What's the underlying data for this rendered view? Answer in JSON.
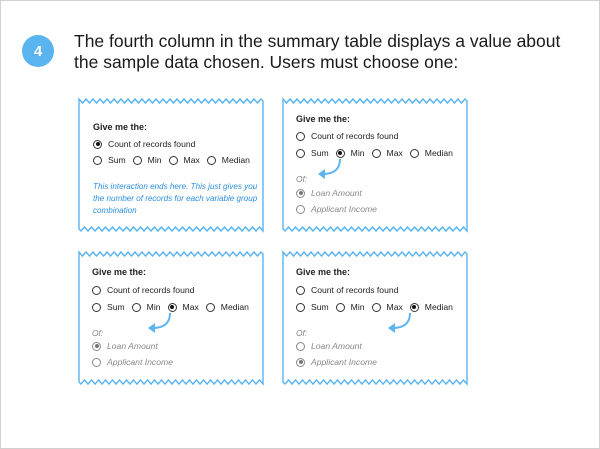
{
  "step": {
    "number": "4"
  },
  "headline": "The fourth column in the summary table displays a value about the sample data chosen.  Users must choose one:",
  "colors": {
    "accent": "#5ab4f0",
    "border": "#5ab4f0",
    "note": "#2a8ee0"
  },
  "cards": [
    {
      "title": "Give me the:",
      "count_label": "Count of records found",
      "count_selected": true,
      "options": [
        {
          "label": "Sum",
          "selected": false
        },
        {
          "label": "Min",
          "selected": false
        },
        {
          "label": "Max",
          "selected": false
        },
        {
          "label": "Median",
          "selected": false
        }
      ],
      "note": "This interaction ends here. This just gives you the number of records for each variable group combination"
    },
    {
      "title": "Give me the:",
      "count_label": "Count of records found",
      "count_selected": false,
      "options": [
        {
          "label": "Sum",
          "selected": false
        },
        {
          "label": "Min",
          "selected": true
        },
        {
          "label": "Max",
          "selected": false
        },
        {
          "label": "Median",
          "selected": false
        }
      ],
      "of_label": "Of:",
      "sources": [
        {
          "label": "Loan Amount",
          "selected": true
        },
        {
          "label": "Applicant Income",
          "selected": false
        }
      ]
    },
    {
      "title": "Give me the:",
      "count_label": "Count of records found",
      "count_selected": false,
      "options": [
        {
          "label": "Sum",
          "selected": false
        },
        {
          "label": "Min",
          "selected": false
        },
        {
          "label": "Max",
          "selected": true
        },
        {
          "label": "Median",
          "selected": false
        }
      ],
      "of_label": "Of:",
      "sources": [
        {
          "label": "Loan Amount",
          "selected": true
        },
        {
          "label": "Applicant Income",
          "selected": false
        }
      ]
    },
    {
      "title": "Give me the:",
      "count_label": "Count of records found",
      "count_selected": false,
      "options": [
        {
          "label": "Sum",
          "selected": false
        },
        {
          "label": "Min",
          "selected": false
        },
        {
          "label": "Max",
          "selected": false
        },
        {
          "label": "Median",
          "selected": true
        }
      ],
      "of_label": "Of:",
      "sources": [
        {
          "label": "Loan Amount",
          "selected": false
        },
        {
          "label": "Applicant Income",
          "selected": true
        }
      ]
    }
  ]
}
